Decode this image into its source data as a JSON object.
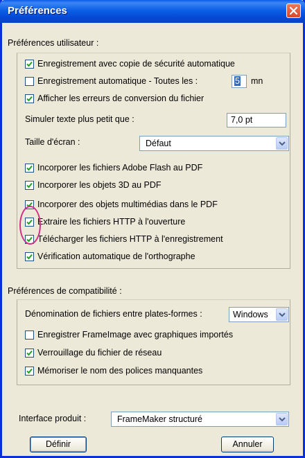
{
  "window": {
    "title": "Préférences",
    "close_icon": "close-icon"
  },
  "user_prefs": {
    "legend": "Préférences utilisateur :",
    "backup": {
      "label": "Enregistrement avec copie de sécurité automatique",
      "checked": true
    },
    "autosave": {
      "label": "Enregistrement automatique - Toutes les :",
      "checked": false,
      "value": "5",
      "unit": "mn"
    },
    "conv_errors": {
      "label": "Afficher les erreurs de conversion du fichier",
      "checked": true
    },
    "simulate_text": {
      "label": "Simuler texte plus petit que :",
      "value": "7,0 pt"
    },
    "screen_size": {
      "label": "Taille d'écran :",
      "value": "Défaut"
    },
    "flash_pdf": {
      "label": "Incorporer les fichiers Adobe Flash au PDF",
      "checked": true
    },
    "obj3d_pdf": {
      "label": "Incorporer les objets 3D au PDF",
      "checked": true
    },
    "multimedia_pdf": {
      "label": "Incorporer des objets multimédias dans le PDF",
      "checked": true
    },
    "http_extract": {
      "label": "Extraire les fichiers HTTP à l'ouverture",
      "checked": true
    },
    "http_upload": {
      "label": "Télécharger les fichiers HTTP à l'enregistrement",
      "checked": true
    },
    "spellcheck": {
      "label": "Vérification automatique de l'orthographe",
      "checked": true
    }
  },
  "compat_prefs": {
    "legend": "Préférences de compatibilité :",
    "naming": {
      "label": "Dénomination de fichiers entre plates-formes :",
      "value": "Windows"
    },
    "frameimage": {
      "label": "Enregistrer FrameImage avec graphiques importés",
      "checked": false
    },
    "net_lock": {
      "label": "Verrouillage du fichier de réseau",
      "checked": true
    },
    "missing_fonts": {
      "label": "Mémoriser le nom des polices manquantes",
      "checked": true
    }
  },
  "product_interface": {
    "label": "Interface produit :",
    "value": "FrameMaker structuré"
  },
  "buttons": {
    "define": "Définir",
    "cancel": "Annuler"
  },
  "colors": {
    "title_bar": "#0a5be8",
    "dialog_bg": "#ece9d8",
    "highlight_circle": "#d52d84"
  }
}
